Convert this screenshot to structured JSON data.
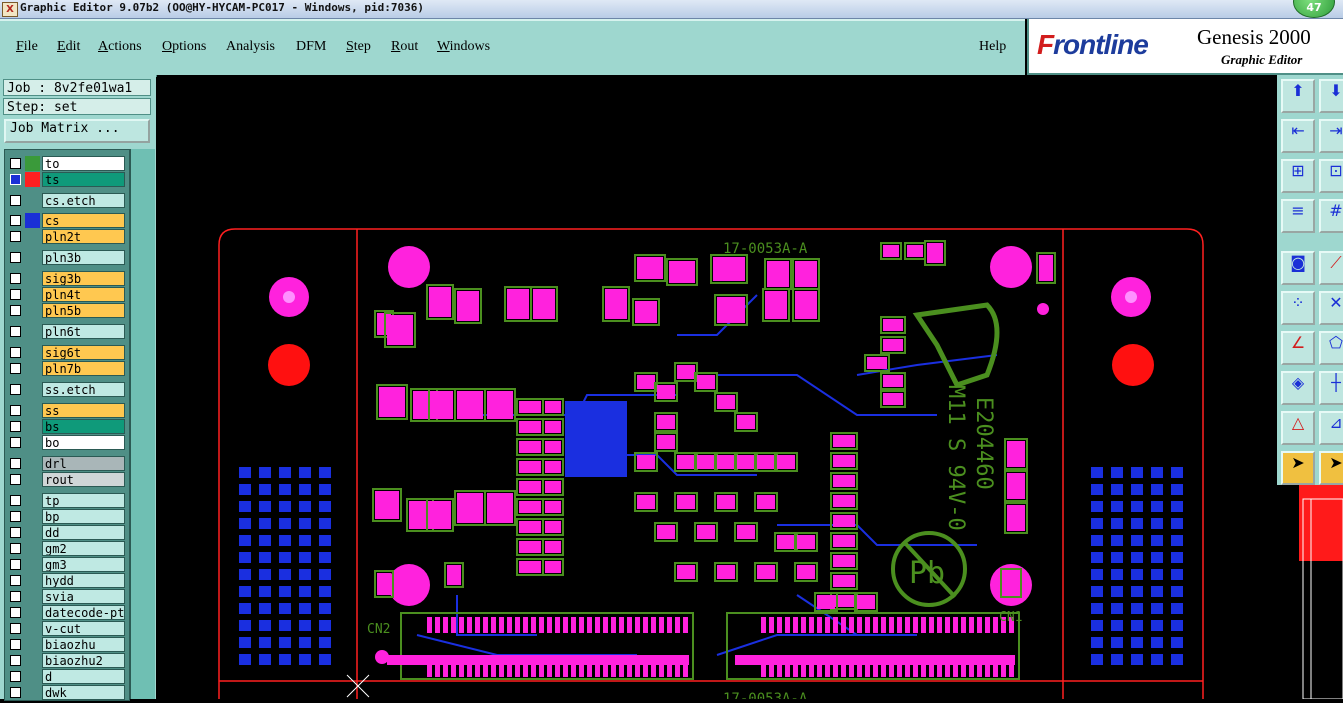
{
  "window": {
    "title": "Graphic Editor 9.07b2 (OO@HY-HYCAM-PC017 - Windows, pid:7036)",
    "notification_count": "47"
  },
  "menu": [
    {
      "label": "File",
      "u": "F",
      "rest": "ile"
    },
    {
      "label": "Edit",
      "u": "E",
      "rest": "dit"
    },
    {
      "label": "Actions",
      "u": "A",
      "rest": "ctions"
    },
    {
      "label": "Options",
      "u": "O",
      "rest": "ptions"
    },
    {
      "label": "Analysis",
      "u": "",
      "rest": "Analysis"
    },
    {
      "label": "DFM",
      "u": "",
      "rest": "DFM"
    },
    {
      "label": "Step",
      "u": "S",
      "rest": "tep"
    },
    {
      "label": "Rout",
      "u": "R",
      "rest": "out"
    },
    {
      "label": "Windows",
      "u": "W",
      "rest": "indows"
    },
    {
      "label": "Help",
      "u": "",
      "rest": "Help"
    }
  ],
  "brand": {
    "logo_f": "F",
    "logo_rest": "rontline",
    "product": "Genesis 2000",
    "subtitle": "Graphic Editor"
  },
  "job": {
    "job_label": "Job : 8v2fe01wa1",
    "step_label": "Step: set",
    "matrix_button": "Job Matrix ..."
  },
  "layers": [
    {
      "name": "to",
      "color": "#ffffff",
      "sw": "#3a9a3a",
      "on": false
    },
    {
      "name": "ts",
      "color": "#0f9a7a",
      "sw": "#ff2020",
      "on": true
    },
    {
      "name": "cs.etch",
      "color": "#bfe9e3",
      "sw": "",
      "on": false
    },
    {
      "name": "cs",
      "color": "#ffc850",
      "sw": "#1a2fd6",
      "on": false
    },
    {
      "name": "pln2t",
      "color": "#ffc850",
      "sw": "",
      "on": false
    },
    {
      "name": "pln3b",
      "color": "#bfe9e3",
      "sw": "",
      "on": false
    },
    {
      "name": "sig3b",
      "color": "#ffc850",
      "sw": "",
      "on": false
    },
    {
      "name": "pln4t",
      "color": "#ffc850",
      "sw": "",
      "on": false
    },
    {
      "name": "pln5b",
      "color": "#ffc850",
      "sw": "",
      "on": false
    },
    {
      "name": "pln6t",
      "color": "#bfe9e3",
      "sw": "",
      "on": false
    },
    {
      "name": "sig6t",
      "color": "#ffc850",
      "sw": "",
      "on": false
    },
    {
      "name": "pln7b",
      "color": "#ffc850",
      "sw": "",
      "on": false
    },
    {
      "name": "ss.etch",
      "color": "#bfe9e3",
      "sw": "",
      "on": false
    },
    {
      "name": "ss",
      "color": "#ffc850",
      "sw": "",
      "on": false
    },
    {
      "name": "bs",
      "color": "#0f9a7a",
      "sw": "",
      "on": false
    },
    {
      "name": "bo",
      "color": "#ffffff",
      "sw": "",
      "on": false
    },
    {
      "name": "drl",
      "color": "#a9b6b8",
      "sw": "",
      "on": false
    },
    {
      "name": "rout",
      "color": "#cfd6d7",
      "sw": "",
      "on": false
    },
    {
      "name": "tp",
      "color": "#bfe9e3",
      "sw": "",
      "on": false
    },
    {
      "name": "bp",
      "color": "#bfe9e3",
      "sw": "",
      "on": false
    },
    {
      "name": "dd",
      "color": "#bfe9e3",
      "sw": "",
      "on": false
    },
    {
      "name": "gm2",
      "color": "#bfe9e3",
      "sw": "",
      "on": false
    },
    {
      "name": "gm3",
      "color": "#bfe9e3",
      "sw": "",
      "on": false
    },
    {
      "name": "hydd",
      "color": "#bfe9e3",
      "sw": "",
      "on": false
    },
    {
      "name": "svia",
      "color": "#bfe9e3",
      "sw": "",
      "on": false
    },
    {
      "name": "datecode-pto",
      "color": "#bfe9e3",
      "sw": "",
      "on": false
    },
    {
      "name": "v-cut",
      "color": "#bfe9e3",
      "sw": "",
      "on": false
    },
    {
      "name": "biaozhu",
      "color": "#bfe9e3",
      "sw": "",
      "on": false
    },
    {
      "name": "biaozhu2",
      "color": "#bfe9e3",
      "sw": "",
      "on": false
    },
    {
      "name": "d",
      "color": "#bfe9e3",
      "sw": "",
      "on": false
    },
    {
      "name": "dwk",
      "color": "#bfe9e3",
      "sw": "",
      "on": false
    }
  ],
  "board": {
    "label_top": "17-0053A-A",
    "label_bottom": "17-0053A-A",
    "ref_cn1": "CN1",
    "ref_cn2": "CN2",
    "silk_code1": "E204460",
    "silk_code2": "M11 S 94V-0",
    "pb_mark": "Pb",
    "colors": {
      "pad": "#ff22dd",
      "trace": "#1a2fe0",
      "outline": "#4b8f1f",
      "silk": "#4b8f1f",
      "fiducial": "#ff1010",
      "frame": "#ff2020"
    }
  },
  "toolbar": [
    "zoom-page-icon",
    "zoom-home-icon",
    "zoom-in-icon",
    "zoom-box-icon",
    "zoom-fit-icon",
    "zoom-center-icon",
    "snap-settings-icon",
    "grid-icon",
    "select-layer-icon",
    "measure-icon",
    "net-icon",
    "cut-icon",
    "line-icon",
    "polygon-icon",
    "feature-icon",
    "axis-icon",
    "triangle-icon",
    "route-icon",
    "pointer-icon",
    "pointer-alt-icon"
  ]
}
